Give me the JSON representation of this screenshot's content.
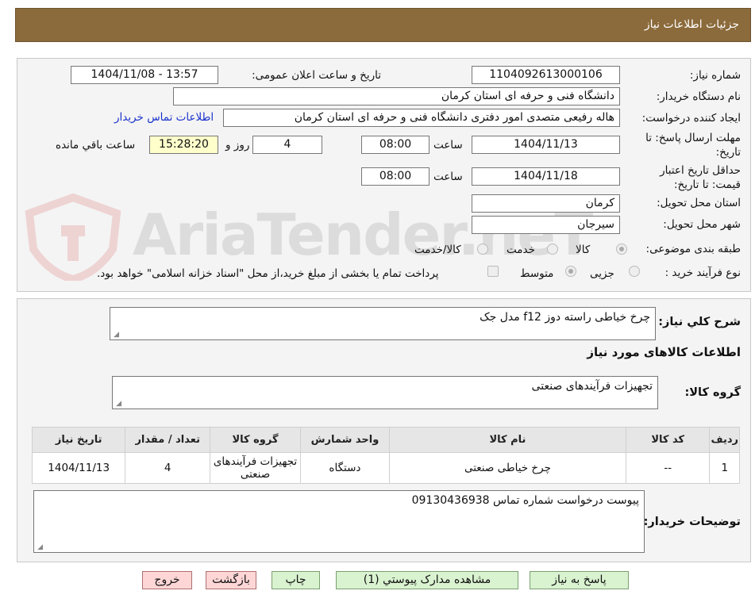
{
  "header": {
    "title": "جزئیات اطلاعات نیاز"
  },
  "form": {
    "need_number_label": "شماره نیاز:",
    "need_number": "1104092613000106",
    "announce_label": "تاریخ و ساعت اعلان عمومی:",
    "announce_value": "1404/11/08 - 13:57",
    "buyer_label": "نام دستگاه خریدار:",
    "buyer_value": "دانشگاه فنی و حرفه ای استان کرمان",
    "creator_label": "ایجاد کننده درخواست:",
    "creator_value": "هاله رفیعی متصدی امور دفتری دانشگاه فنی و حرفه ای استان کرمان",
    "contact_link": "اطلاعات تماس خریدار",
    "reply_deadline_label": "مهلت ارسال پاسخ: تا تاریخ:",
    "reply_date": "1404/11/13",
    "hour_label": "ساعت",
    "reply_time": "08:00",
    "days_value": "4",
    "days_label": "روز و",
    "remaining_time": "15:28:20",
    "remaining_label": "ساعت باقي مانده",
    "validity_label": "حداقل تاریخ اعتبار قیمت: تا تاریخ:",
    "validity_date": "1404/11/18",
    "validity_hour_label": "ساعت",
    "validity_time": "08:00",
    "province_label": "استان محل تحویل:",
    "province_value": "کرمان",
    "city_label": "شهر محل تحویل:",
    "city_value": "سیرجان",
    "category_label": "طبقه بندی موضوعی:",
    "category_options": [
      "کالا",
      "خدمت",
      "کالا/خدمت"
    ],
    "process_label": "نوع فرآیند خرید :",
    "process_options": [
      "جزیی",
      "متوسط"
    ],
    "payment_note": "پرداخت تمام یا بخشی از مبلغ خرید،از محل \"اسناد خزانه اسلامی\" خواهد بود."
  },
  "details": {
    "summary_label": "شرح کلي نياز:",
    "summary_value": "چرخ خیاطی راسته دوز f12 مدل جک",
    "goods_info_title": "اطلاعات کالاهای مورد نیاز",
    "goods_group_label": "گروه کالا:",
    "goods_group_value": "تجهیزات فرآیندهای صنعتی",
    "table": {
      "headers": [
        "ردیف",
        "کد کالا",
        "نام کالا",
        "واحد شمارش",
        "گروه کالا",
        "تعداد / مقدار",
        "تاریخ نیاز"
      ],
      "rows": [
        [
          "1",
          "--",
          "چرخ خیاطی صنعتی",
          "دستگاه",
          "تجهیزات فرآیندهای صنعتی",
          "4",
          "1404/11/13"
        ]
      ]
    },
    "buyer_notes_label": "توضیحات خریدار:",
    "buyer_notes_value": "پیوست درخواست شماره تماس 09130436938"
  },
  "buttons": {
    "reply": "پاسخ به نیاز",
    "attachments": "مشاهده مدارک پیوستي (1)",
    "print": "چاپ",
    "back": "بازگشت",
    "exit": "خروج"
  },
  "watermark": {
    "text": "AriaTender.neT"
  },
  "colors": {
    "header_bg": "#8b6a3b",
    "link": "#1a33cc",
    "highlight": "#ffffcc",
    "btn_green": "#d9f2d0",
    "btn_pink": "#ffd6d6"
  }
}
